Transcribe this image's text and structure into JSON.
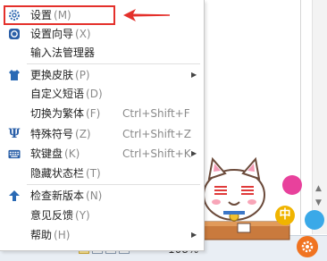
{
  "menu": {
    "items": [
      {
        "label": "设置",
        "hotkey": "(M)",
        "icon": "gear-icon",
        "highlighted": true
      },
      {
        "label": "设置向导",
        "hotkey": "(X)",
        "icon": "wizard-icon"
      },
      {
        "label": "输入法管理器",
        "hotkey": ""
      },
      {
        "label": "更换皮肤",
        "hotkey": "(P)",
        "icon": "shirt-icon",
        "submenu": true
      },
      {
        "label": "自定义短语",
        "hotkey": "(D)"
      },
      {
        "label": "切换为繁体",
        "hotkey": "(F)",
        "shortcut": "Ctrl+Shift+F"
      },
      {
        "label": "特殊符号",
        "hotkey": "(Z)",
        "icon": "psi-icon",
        "shortcut": "Ctrl+Shift+Z"
      },
      {
        "label": "软键盘",
        "hotkey": "(K)",
        "icon": "keyboard-icon",
        "shortcut": "Ctrl+Shift+K",
        "submenu": true
      },
      {
        "label": "隐藏状态栏",
        "hotkey": "(T)"
      },
      {
        "label": "检查新版本",
        "hotkey": "(N)",
        "icon": "up-arrow-icon"
      },
      {
        "label": "意见反馈",
        "hotkey": "(Y)"
      },
      {
        "label": "帮助",
        "hotkey": "(H)",
        "submenu": true
      }
    ]
  },
  "status_bar": {
    "zoom": "108%"
  },
  "input_badge": {
    "label": "中"
  },
  "colors": {
    "highlight": "#e4302b",
    "accent_blue": "#1e6fb8"
  }
}
